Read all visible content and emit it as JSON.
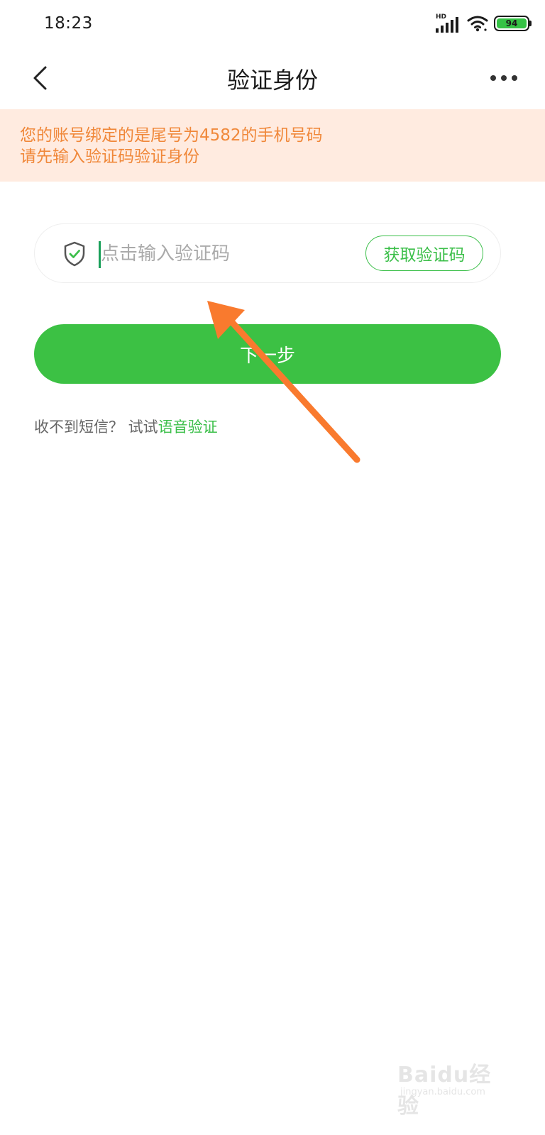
{
  "status_bar": {
    "time": "18:23",
    "network_label": "HD",
    "battery_level": "94"
  },
  "title_bar": {
    "title": "验证身份"
  },
  "notice": {
    "line1": "您的账号绑定的是尾号为4582的手机号码",
    "line2": "请先输入验证码验证身份"
  },
  "verification": {
    "placeholder": "点击输入验证码",
    "get_code_label": "获取验证码"
  },
  "next_button": {
    "label": "下一步"
  },
  "voice_hint": {
    "prefix": "收不到短信？ 试试",
    "link": "语音验证"
  },
  "watermark": {
    "brand": "Baidu经验",
    "url": "jingyan.baidu.com"
  },
  "colors": {
    "accent": "#3cc144",
    "notice_bg": "#ffebe0",
    "notice_text": "#f0883a",
    "annotation": "#f97a2e"
  }
}
